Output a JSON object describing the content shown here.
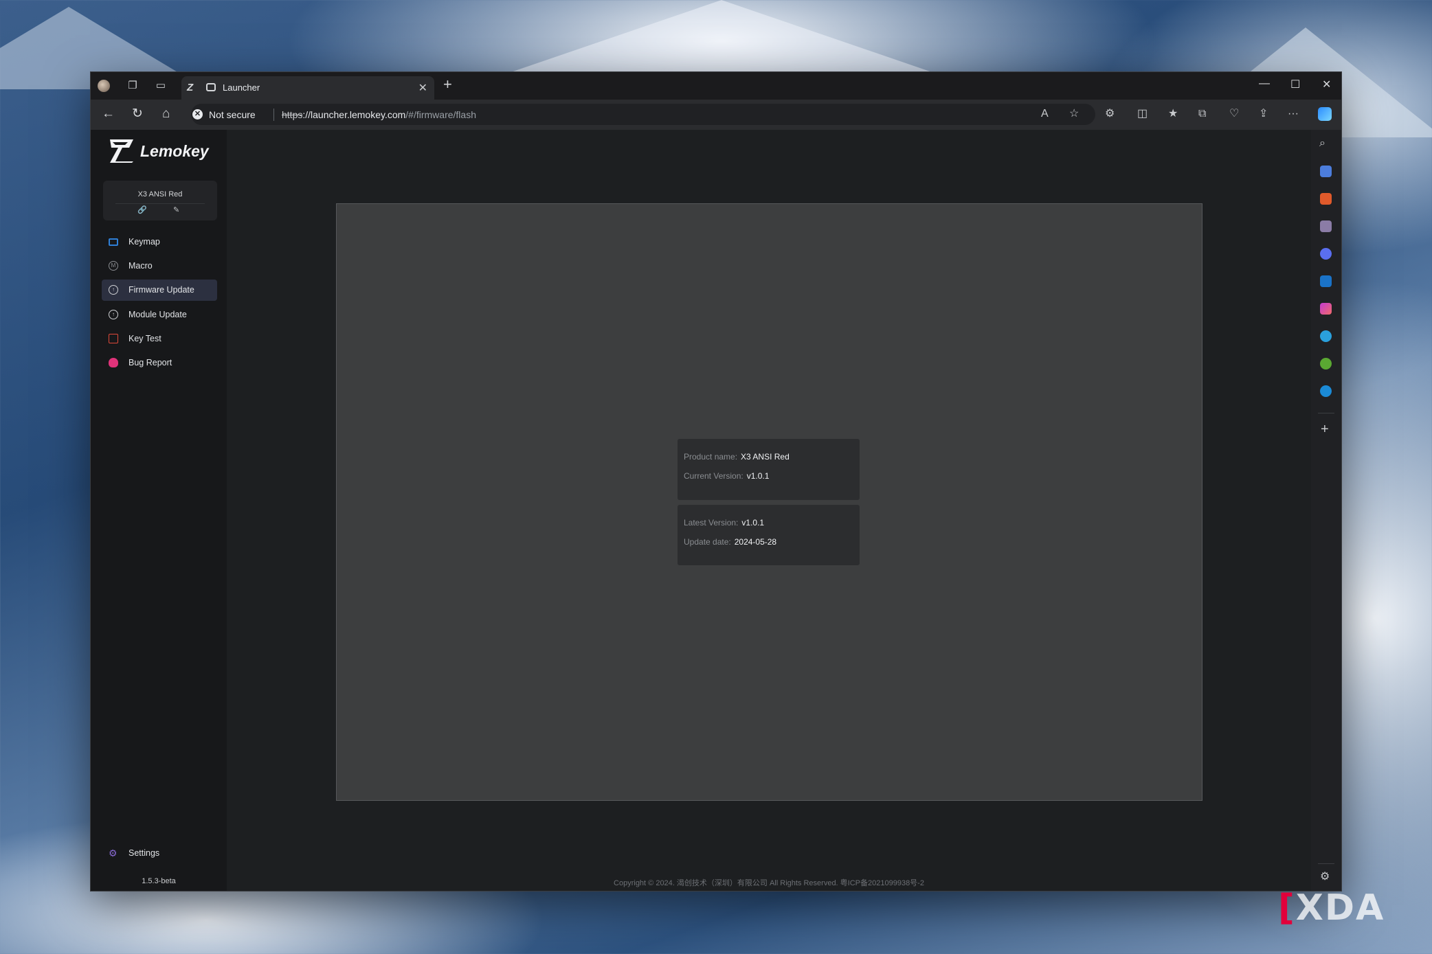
{
  "browser": {
    "tab_title": "Launcher",
    "security_label": "Not secure",
    "url_scheme": "https",
    "url_host": "://launcher.lemokey.com",
    "url_path": "/#/firmware/flash"
  },
  "app": {
    "brand": "Lemokey",
    "device": {
      "name": "X3 ANSI Red"
    },
    "menu": [
      {
        "label": "Keymap",
        "icon": "keyboard-icon"
      },
      {
        "label": "Macro",
        "icon": "macro-icon"
      },
      {
        "label": "Firmware Update",
        "icon": "firmware-icon"
      },
      {
        "label": "Module Update",
        "icon": "module-icon"
      },
      {
        "label": "Key Test",
        "icon": "key-test-icon"
      },
      {
        "label": "Bug Report",
        "icon": "bug-icon"
      }
    ],
    "active_menu": "Firmware Update",
    "settings_label": "Settings",
    "version": "1.5.3-beta"
  },
  "firmware": {
    "product_label": "Product name:",
    "product_value": "X3 ANSI Red",
    "current_label": "Current Version:",
    "current_value": "v1.0.1",
    "latest_label": "Latest Version:",
    "latest_value": "v1.0.1",
    "date_label": "Update date:",
    "date_value": "2024-05-28"
  },
  "footer": "Copyright © 2024. 渴创技术（深圳）有限公司 All Rights Reserved. 粤ICP备2021099938号-2",
  "watermark": "XDA",
  "colors": {
    "active_menu_bg": "#2c3040",
    "panel_bg": "#3d3e3f",
    "card_bg": "#2c2d2f"
  }
}
